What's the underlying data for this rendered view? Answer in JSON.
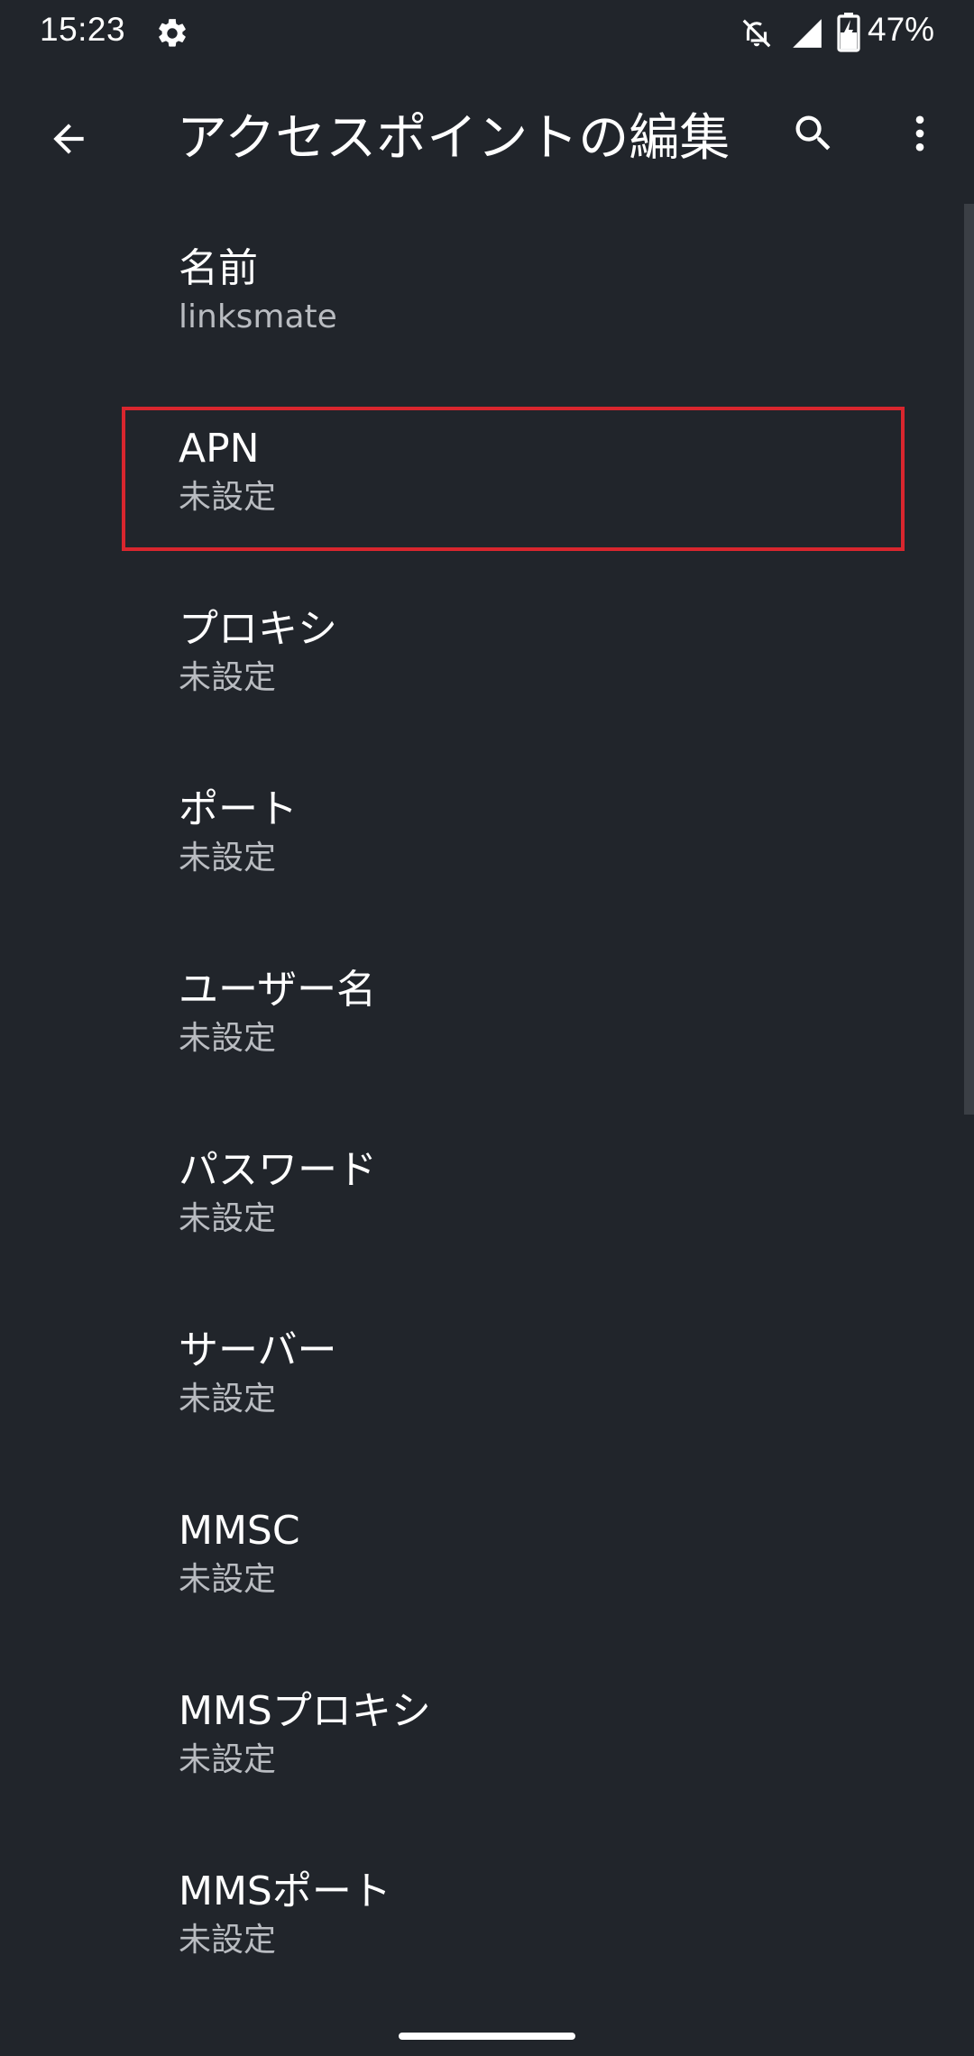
{
  "status_bar": {
    "time": "15:23",
    "battery_percent": "47%",
    "icons": [
      "gear-icon",
      "notifications-off-icon",
      "cell-signal-icon",
      "battery-charging-icon"
    ]
  },
  "app_bar": {
    "title": "アクセスポイントの編集",
    "icons": [
      "arrow-back-icon",
      "search-icon",
      "more-vert-icon"
    ]
  },
  "preferences": [
    {
      "title": "名前",
      "summary": "linksmate"
    },
    {
      "title": "APN",
      "summary": "未設定"
    },
    {
      "title": "プロキシ",
      "summary": "未設定"
    },
    {
      "title": "ポート",
      "summary": "未設定"
    },
    {
      "title": "ユーザー名",
      "summary": "未設定"
    },
    {
      "title": "パスワード",
      "summary": "未設定"
    },
    {
      "title": "サーバー",
      "summary": "未設定"
    },
    {
      "title": "MMSC",
      "summary": "未設定"
    },
    {
      "title": "MMSプロキシ",
      "summary": "未設定"
    },
    {
      "title": "MMSポート",
      "summary": "未設定"
    }
  ],
  "colors": {
    "background": "#21252b",
    "text_primary": "#ffffff",
    "text_secondary": "#b9bcc1",
    "highlight": "#d9262e"
  }
}
